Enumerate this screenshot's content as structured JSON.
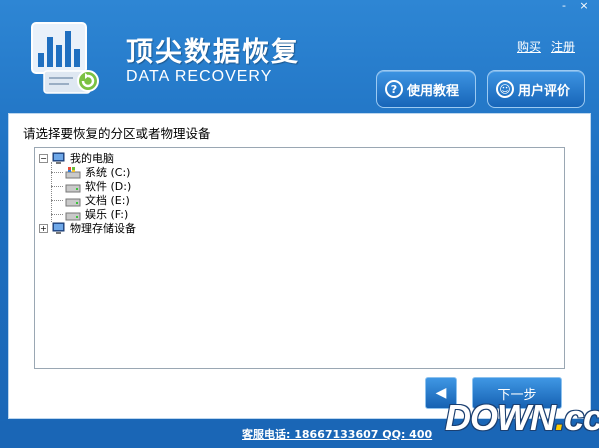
{
  "window": {
    "controls": [
      "-",
      "×"
    ]
  },
  "header": {
    "title": "顶尖数据恢复",
    "subtitle": "DATA RECOVERY",
    "links": {
      "buy": "购买",
      "register": "注册"
    },
    "tutorial_label": "使用教程",
    "review_label": "用户评价",
    "tutorial_icon": "?",
    "review_icon": "☺"
  },
  "main": {
    "prompt": "请选择要恢复的分区或者物理设备",
    "tree": {
      "root": {
        "label": "我的电脑",
        "expander": "−"
      },
      "partitions": [
        {
          "label": "系统 (C:)"
        },
        {
          "label": "软件 (D:)"
        },
        {
          "label": "文档 (E:)"
        },
        {
          "label": "娱乐 (F:)"
        }
      ],
      "physical": {
        "label": "物理存储设备",
        "expander": "+"
      }
    }
  },
  "nav": {
    "back_label": "◀",
    "next_label": "下一步"
  },
  "footer": {
    "contact": "客服电话: 18667133607 QQ: 400"
  },
  "watermark": {
    "main": "DOWN",
    "dot": ".",
    "tld": "cc"
  },
  "colors": {
    "primary": "#1d6fc0",
    "panel": "#ffffff",
    "accent": "#ffcc00"
  }
}
